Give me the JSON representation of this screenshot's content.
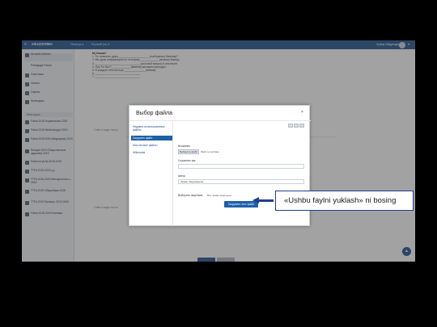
{
  "navbar": {
    "brand": "edu@DSMU",
    "links": [
      "Помощь ▾",
      "Русский (ru) ▾"
    ],
    "user_name": "Зуфар Абдукадиров"
  },
  "sidebar": {
    "items": [
      "Личный кабинет",
      "Pedagogik Fanlar",
      "Участники",
      "Значки",
      "Оценки",
      "Календарь"
    ],
    "section": "Мои курсы",
    "courses": [
      "Fizika 2018 Нормальная 2019",
      "Fizika 2018 Medbiologiya 2019",
      "Fizika 2018 ESN (Медицина) 2019",
      "Ruhiyat 2019 Общественное здоровье 2019",
      "Fizika bo'yicha 2018-2019",
      "TTFA 2019-2020 y.y.",
      "TTFA 2019-2020 Методология з... 2019",
      "TTFA 2019 Общеобраз.2018",
      "TTFA 2019 Профор. 2019-2020",
      "Fizika 2018-2019 Клиника"
    ]
  },
  "main": {
    "question_title": "Ы) Кошка?",
    "lines": [
      "1. Ты позвонил другу ____________________ (сообщение) Иванову?",
      "2. Мы дали информацию по телефону ____________ (знаком) Вазиру.",
      "3. ______________________________ (сильный вопрос) в институте",
      "4. При Ты был? ____________ (важной) месяцем приходил",
      "5. В каждый тебя месяца ______________ (знаков).",
      "6. ______________________________",
      "7. ______________________________"
    ],
    "note_1": "Ответ в виде текста",
    "note_2": "Ответ в виде текста"
  },
  "dialog": {
    "title": "Выбор файла",
    "repositories": [
      "Недавно использованные файлы",
      "Загрузить файл",
      "Мои личные файлы",
      "Wikimedia"
    ],
    "attachment_label": "Вложение",
    "choose_button": "Выберите файл",
    "no_file": "Файл не выбран",
    "save_as_label": "Сохранить как",
    "author_label": "Автор",
    "author_value": "Зуфар Абдукадиров",
    "license_label": "Выберите лицензию",
    "license_value": "Все права защищены",
    "upload_button": "Загрузить этот файл"
  },
  "callout": {
    "text": "«Ushbu faylni yuklash» ni bosing"
  },
  "colors": {
    "navbar": "#1e4f8a",
    "primary_button": "#1e5fa8",
    "callout_border": "#1f3f8f"
  }
}
